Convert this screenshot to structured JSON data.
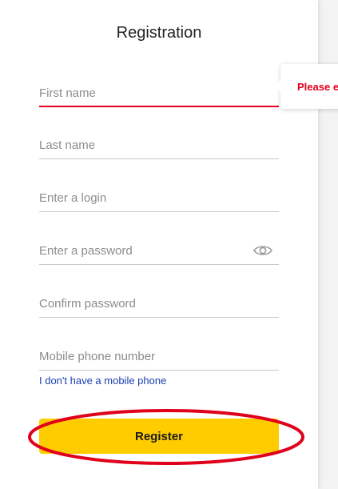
{
  "form": {
    "title": "Registration",
    "fields": [
      {
        "placeholder": "First name",
        "value": ""
      },
      {
        "placeholder": "Last name",
        "value": ""
      },
      {
        "placeholder": "Enter a login",
        "value": ""
      },
      {
        "placeholder": "Enter a password",
        "value": ""
      },
      {
        "placeholder": "Confirm password",
        "value": ""
      },
      {
        "placeholder": "Mobile phone number",
        "value": ""
      }
    ],
    "no_phone_link": "I don't have a mobile phone",
    "register_label": "Register"
  },
  "error_tooltip": {
    "text": "Please e"
  },
  "icons": {
    "password_toggle": "eye-icon"
  },
  "colors": {
    "accent": "#ffcc00",
    "error": "#e0001b",
    "link": "#1a3fb0",
    "annotation": "#e0001b"
  }
}
